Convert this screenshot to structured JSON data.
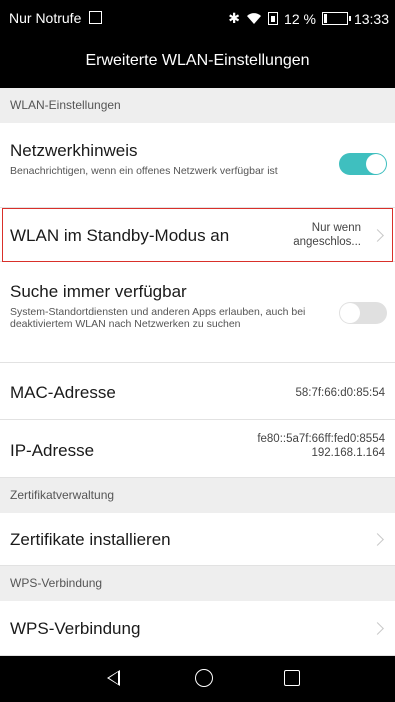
{
  "status_bar": {
    "carrier": "Nur Notrufe",
    "bluetooth_icon": "✱",
    "wifi_icon": "wifi-icon",
    "battery_percent": "12 %",
    "battery_level": 0.12,
    "time": "13:33"
  },
  "header": {
    "title": "Erweiterte WLAN-Einstellungen"
  },
  "sections": {
    "wlan": "WLAN-Einstellungen",
    "certs": "Zertifikatverwaltung",
    "wps": "WPS-Verbindung"
  },
  "network_notice": {
    "title": "Netzwerkhinweis",
    "subtitle": "Benachrichtigen, wenn ein offenes Netzwerk verfügbar ist",
    "enabled": true
  },
  "standby": {
    "title": "WLAN im Standby-Modus an",
    "value_line1": "Nur wenn",
    "value_line2": "angeschlos..."
  },
  "scan_always": {
    "title": "Suche immer verfügbar",
    "subtitle": "System-Standortdiensten und anderen Apps erlauben, auch bei deaktiviertem WLAN nach Netzwerken zu suchen",
    "enabled": false
  },
  "mac": {
    "title": "MAC-Adresse",
    "value": "58:7f:66:d0:85:54"
  },
  "ip": {
    "title": "IP-Adresse",
    "value_line1": "fe80::5a7f:66ff:fed0:8554",
    "value_line2": "192.168.1.164"
  },
  "install_certs": {
    "title": "Zertifikate installieren"
  },
  "wps_connect": {
    "title": "WPS-Verbindung"
  },
  "colors": {
    "accent": "#3fbfbf",
    "toggle_off": "#e0e0e0",
    "highlight": "#d9302a"
  }
}
